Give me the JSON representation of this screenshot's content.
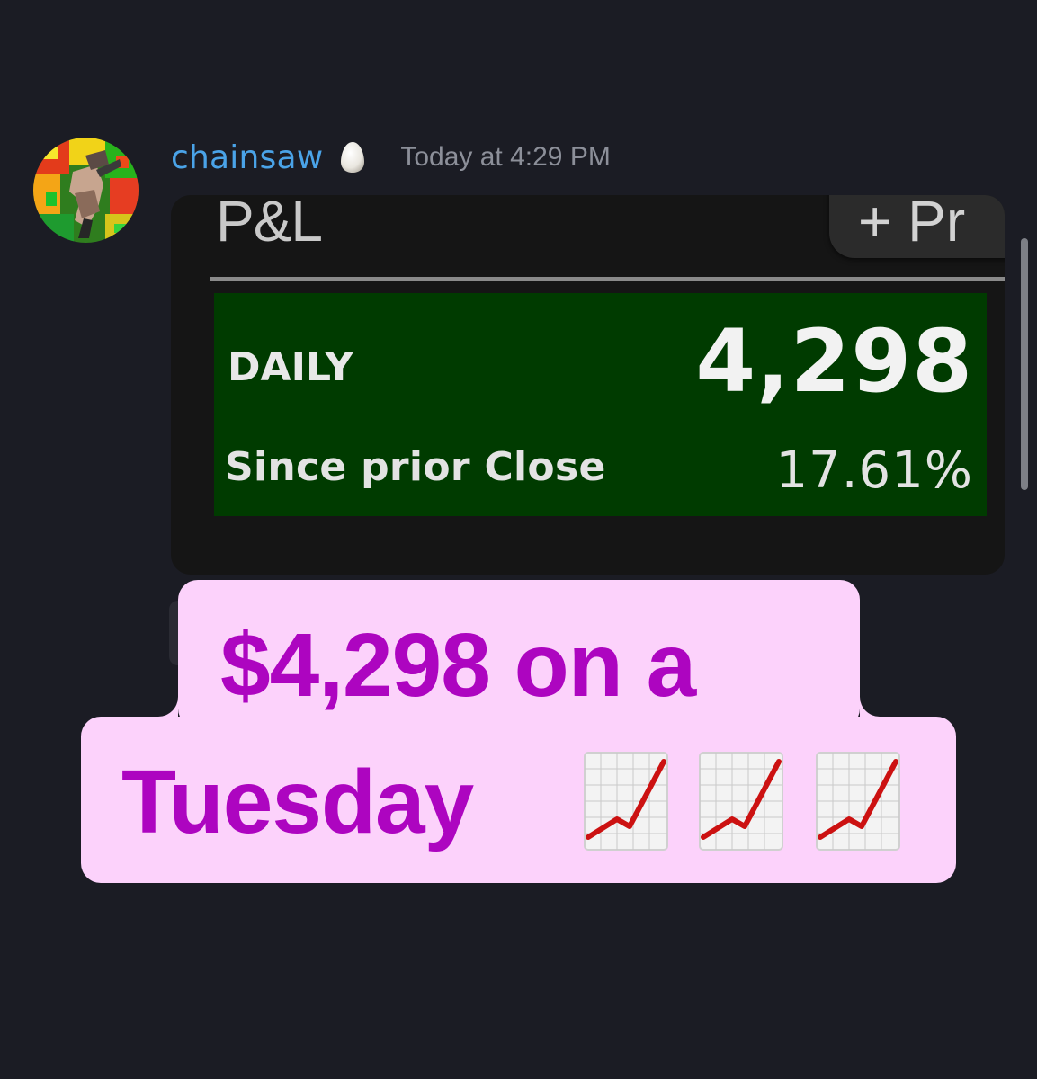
{
  "message": {
    "username": "chainsaw",
    "status_icon": "egg-icon",
    "timestamp": "Today at 4:29 PM"
  },
  "attachment": {
    "section_title": "P&L",
    "button_label": "+ Pr",
    "daily_label": "DAILY",
    "daily_value": "4,298",
    "since_label": "Since prior Close",
    "since_value": "17.61%",
    "box_color": "#003b00"
  },
  "caption": {
    "line1": "$4,298 on a",
    "line2": "Tuesday",
    "emoji": [
      "chart-increasing-icon",
      "chart-increasing-icon",
      "chart-increasing-icon"
    ],
    "text_color": "#ad05c0",
    "background_color": "#fcd2fb"
  },
  "colors": {
    "background": "#1b1c24",
    "username": "#4aa3e8",
    "timestamp": "#8c8f99"
  }
}
